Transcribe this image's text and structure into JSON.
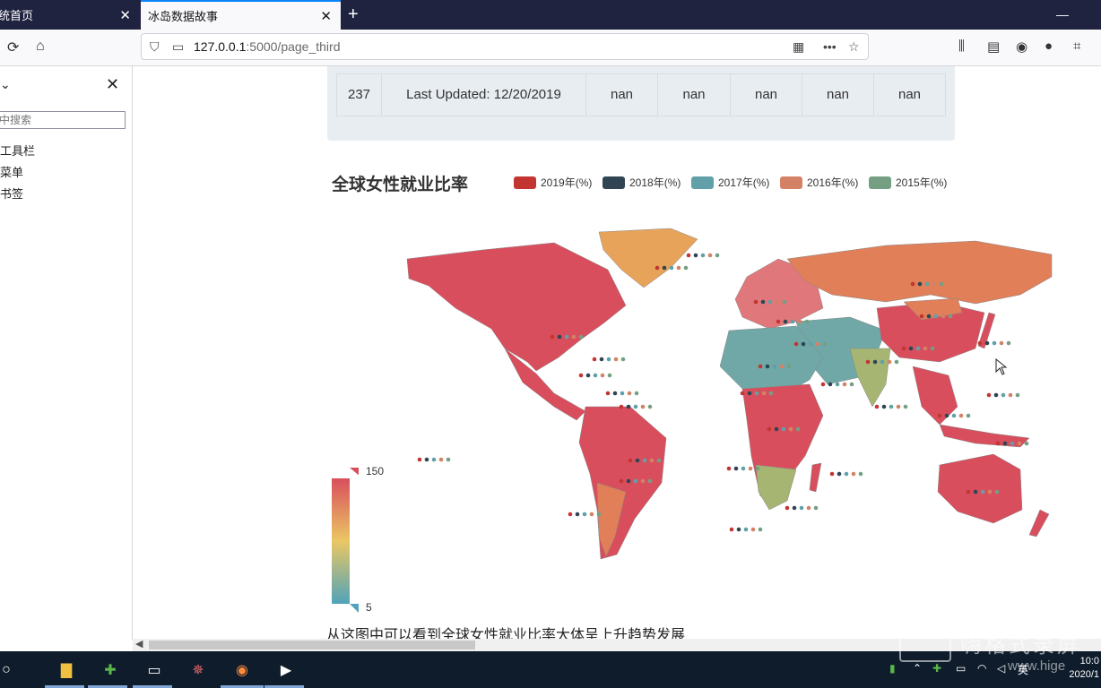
{
  "browser": {
    "tabs": [
      {
        "label": "统首页"
      },
      {
        "label": "冰岛数据故事"
      }
    ],
    "url_host": "127.0.0.1",
    "url_path": ":5000/page_third"
  },
  "sidebar": {
    "header_chevron": "⌄",
    "search_placeholder": "中搜索",
    "items": [
      "工具栏",
      "菜单",
      "书签"
    ]
  },
  "table": {
    "row": [
      "237",
      "Last Updated: 12/20/2019",
      "nan",
      "nan",
      "nan",
      "nan",
      "nan"
    ]
  },
  "map_chart": {
    "title": "全球女性就业比率",
    "legend": [
      {
        "label": "2019年(%)",
        "color": "#c23531"
      },
      {
        "label": "2018年(%)",
        "color": "#2f4554"
      },
      {
        "label": "2017年(%)",
        "color": "#61a0a8"
      },
      {
        "label": "2016年(%)",
        "color": "#d48265"
      },
      {
        "label": "2015年(%)",
        "color": "#749f83"
      }
    ],
    "visual_map": {
      "max": "150",
      "min": "5"
    }
  },
  "caption": "从这图中可以看到全球女性就业比率大体呈上升趋势发展",
  "taskbar": {
    "clock_time": "10:0",
    "clock_date": "2020/1",
    "ime": "英"
  },
  "watermark": {
    "text": "嗨格式录屏",
    "url": "www.hige"
  }
}
